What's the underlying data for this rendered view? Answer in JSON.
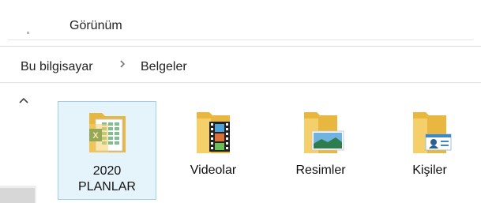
{
  "ribbon": {
    "tab_view": "Görünüm"
  },
  "breadcrumb": {
    "root": "Bu bilgisayar",
    "separator": ">",
    "current": "Belgeler"
  },
  "items": [
    {
      "label": "2020\nPLANLAR",
      "icon": "excel-folder-icon",
      "selected": true
    },
    {
      "label": "Videolar",
      "icon": "videos-folder-icon"
    },
    {
      "label": "Resimler",
      "icon": "pictures-folder-icon"
    },
    {
      "label": "Kişiler",
      "icon": "contacts-folder-icon"
    }
  ],
  "colors": {
    "folder": "#f5cf6a",
    "folder_back": "#e8b73f",
    "selection": "#e5f3fb",
    "selection_border": "#9ed0f1",
    "excel": "#1d7a43"
  }
}
